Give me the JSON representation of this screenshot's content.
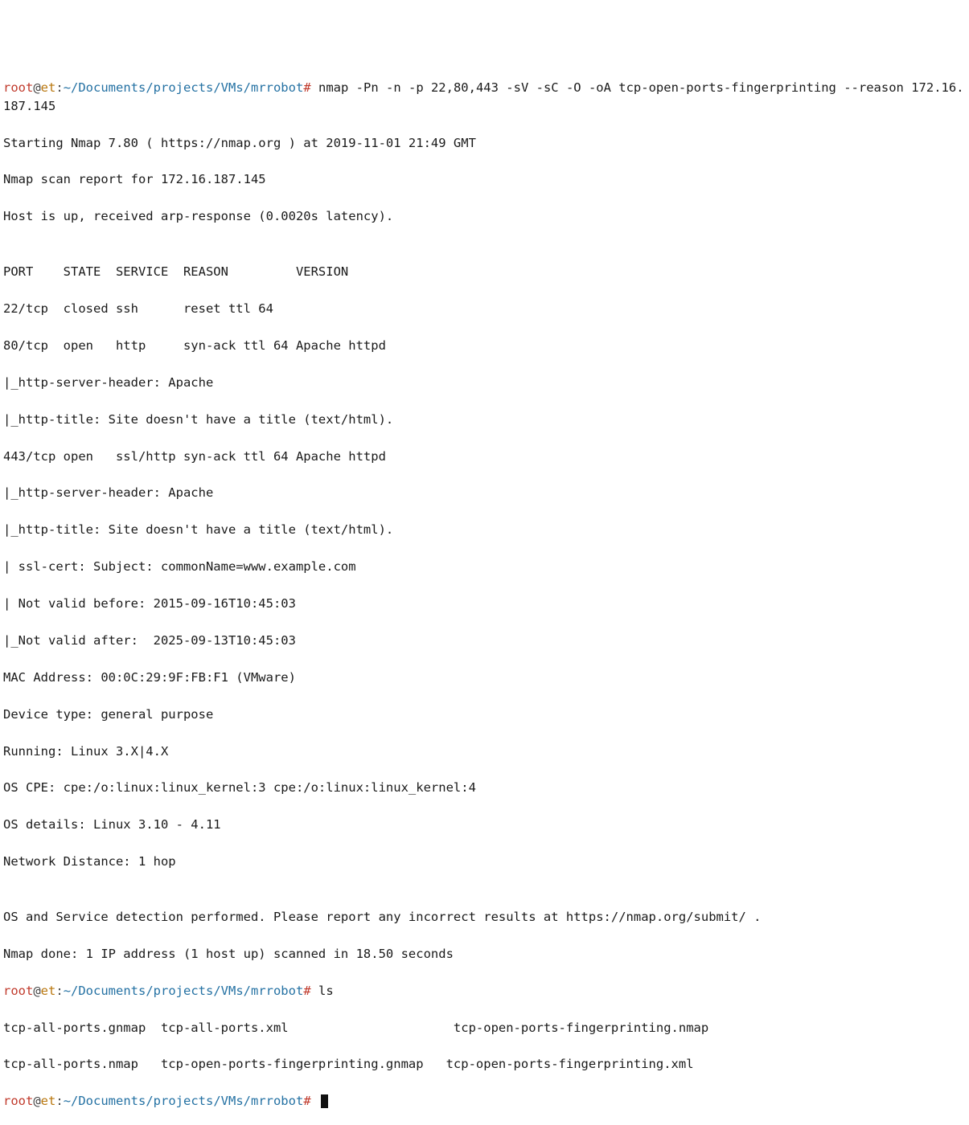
{
  "prompt": {
    "user": "root",
    "at": "@",
    "host": "et",
    "colon": ":",
    "path": "~/Documents/projects/VMs/mrrobot",
    "hash": "#"
  },
  "cmd1": "nmap -Pn -n -p 22,80,443 -sV -sC -O -oA tcp-open-ports-fingerprinting --reason 172.16.187.145",
  "out": {
    "l01": "Starting Nmap 7.80 ( https://nmap.org ) at 2019-11-01 21:49 GMT",
    "l02": "Nmap scan report for 172.16.187.145",
    "l03": "Host is up, received arp-response (0.0020s latency).",
    "l04": "",
    "l05": "PORT    STATE  SERVICE  REASON         VERSION",
    "l06": "22/tcp  closed ssh      reset ttl 64",
    "l07": "80/tcp  open   http     syn-ack ttl 64 Apache httpd",
    "l08": "|_http-server-header: Apache",
    "l09": "|_http-title: Site doesn't have a title (text/html).",
    "l10": "443/tcp open   ssl/http syn-ack ttl 64 Apache httpd",
    "l11": "|_http-server-header: Apache",
    "l12": "|_http-title: Site doesn't have a title (text/html).",
    "l13": "| ssl-cert: Subject: commonName=www.example.com",
    "l14": "| Not valid before: 2015-09-16T10:45:03",
    "l15": "|_Not valid after:  2025-09-13T10:45:03",
    "l16": "MAC Address: 00:0C:29:9F:FB:F1 (VMware)",
    "l17": "Device type: general purpose",
    "l18": "Running: Linux 3.X|4.X",
    "l19": "OS CPE: cpe:/o:linux:linux_kernel:3 cpe:/o:linux:linux_kernel:4",
    "l20": "OS details: Linux 3.10 - 4.11",
    "l21": "Network Distance: 1 hop",
    "l22": "",
    "l23": "OS and Service detection performed. Please report any incorrect results at https://nmap.org/submit/ .",
    "l24": "Nmap done: 1 IP address (1 host up) scanned in 18.50 seconds"
  },
  "cmd2": "ls",
  "ls": {
    "l1": "tcp-all-ports.gnmap  tcp-all-ports.xml                      tcp-open-ports-fingerprinting.nmap",
    "l2": "tcp-all-ports.nmap   tcp-open-ports-fingerprinting.gnmap   tcp-open-ports-fingerprinting.xml"
  }
}
